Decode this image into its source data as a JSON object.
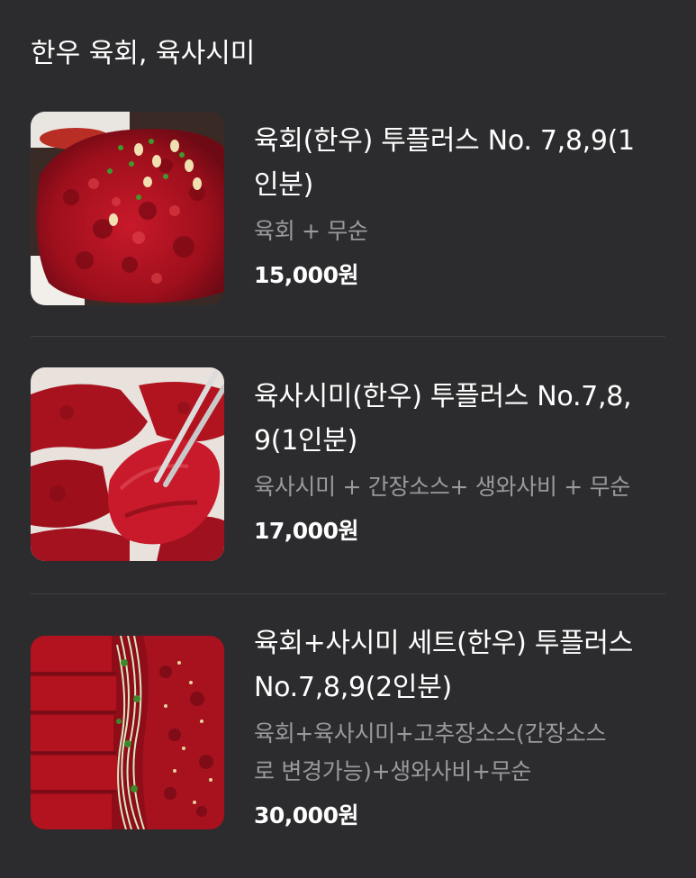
{
  "section": {
    "title": "한우 육회, 육사시미"
  },
  "items": [
    {
      "name_line1": "육회(한우) 투플러스 No. 7,8,9(1",
      "name_line2": "인분)",
      "desc_line1": "육회 + 무순",
      "desc_line2": "",
      "price": "15,000원",
      "image_icon": "yukhoe-photo"
    },
    {
      "name_line1": "육사시미(한우) 투플러스 No.7,8,",
      "name_line2": "9(1인분)",
      "desc_line1": "육사시미 + 간장소스+ 생와사비 + 무순",
      "desc_line2": "",
      "price": "17,000원",
      "image_icon": "raw-beef-sashimi-photo"
    },
    {
      "name_line1": "육회+사시미 세트(한우) 투플러스",
      "name_line2": "No.7,8,9(2인분)",
      "desc_line1": "육회+육사시미+고추장소스(간장소스",
      "desc_line2": "로 변경가능)+생와사비+무순",
      "price": "30,000원",
      "image_icon": "yukhoe-sashimi-set-photo"
    }
  ],
  "colors": {
    "background": "#2c2c2e",
    "title_text": "#ffffff",
    "description_text": "#9a9a9c",
    "divider": "#3f3f42",
    "meat_red": "#b3121f"
  }
}
